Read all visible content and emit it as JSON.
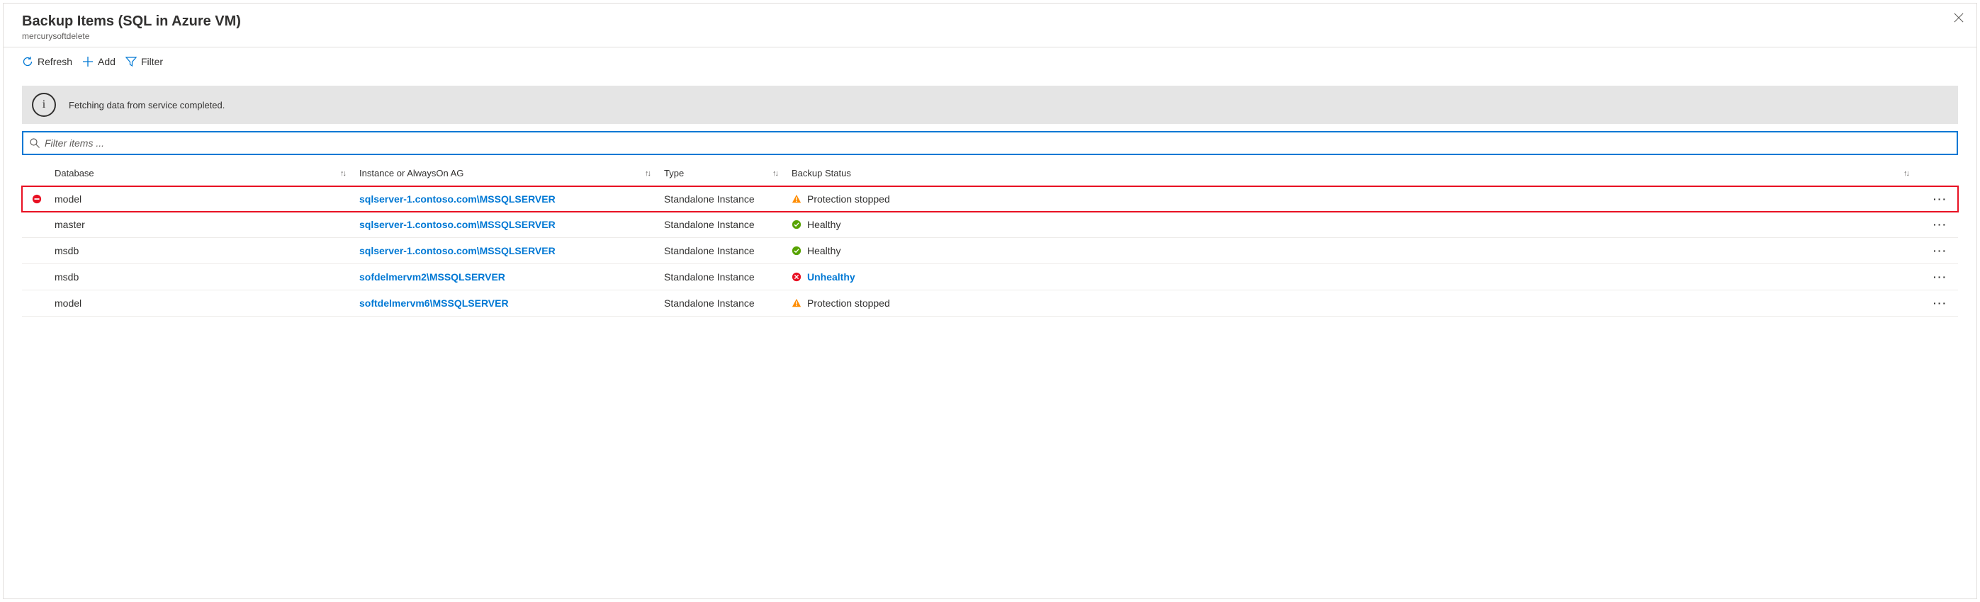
{
  "header": {
    "title": "Backup Items (SQL in Azure VM)",
    "subtitle": "mercurysoftdelete"
  },
  "toolbar": {
    "refresh": "Refresh",
    "add": "Add",
    "filter": "Filter"
  },
  "info_message": "Fetching data from service completed.",
  "filter_placeholder": "Filter items ...",
  "columns": {
    "database": "Database",
    "instance": "Instance or AlwaysOn AG",
    "type": "Type",
    "status": "Backup Status"
  },
  "rows": [
    {
      "database": "model",
      "instance": "sqlserver-1.contoso.com\\MSSQLSERVER",
      "type": "Standalone Instance",
      "status": "Protection stopped",
      "status_kind": "warning",
      "highlighted": true,
      "row_icon": "stop"
    },
    {
      "database": "master",
      "instance": "sqlserver-1.contoso.com\\MSSQLSERVER",
      "type": "Standalone Instance",
      "status": "Healthy",
      "status_kind": "healthy"
    },
    {
      "database": "msdb",
      "instance": "sqlserver-1.contoso.com\\MSSQLSERVER",
      "type": "Standalone Instance",
      "status": "Healthy",
      "status_kind": "healthy"
    },
    {
      "database": "msdb",
      "instance": "sofdelmervm2\\MSSQLSERVER",
      "type": "Standalone Instance",
      "status": "Unhealthy",
      "status_kind": "unhealthy"
    },
    {
      "database": "model",
      "instance": "softdelmervm6\\MSSQLSERVER",
      "type": "Standalone Instance",
      "status": "Protection stopped",
      "status_kind": "warning"
    }
  ]
}
